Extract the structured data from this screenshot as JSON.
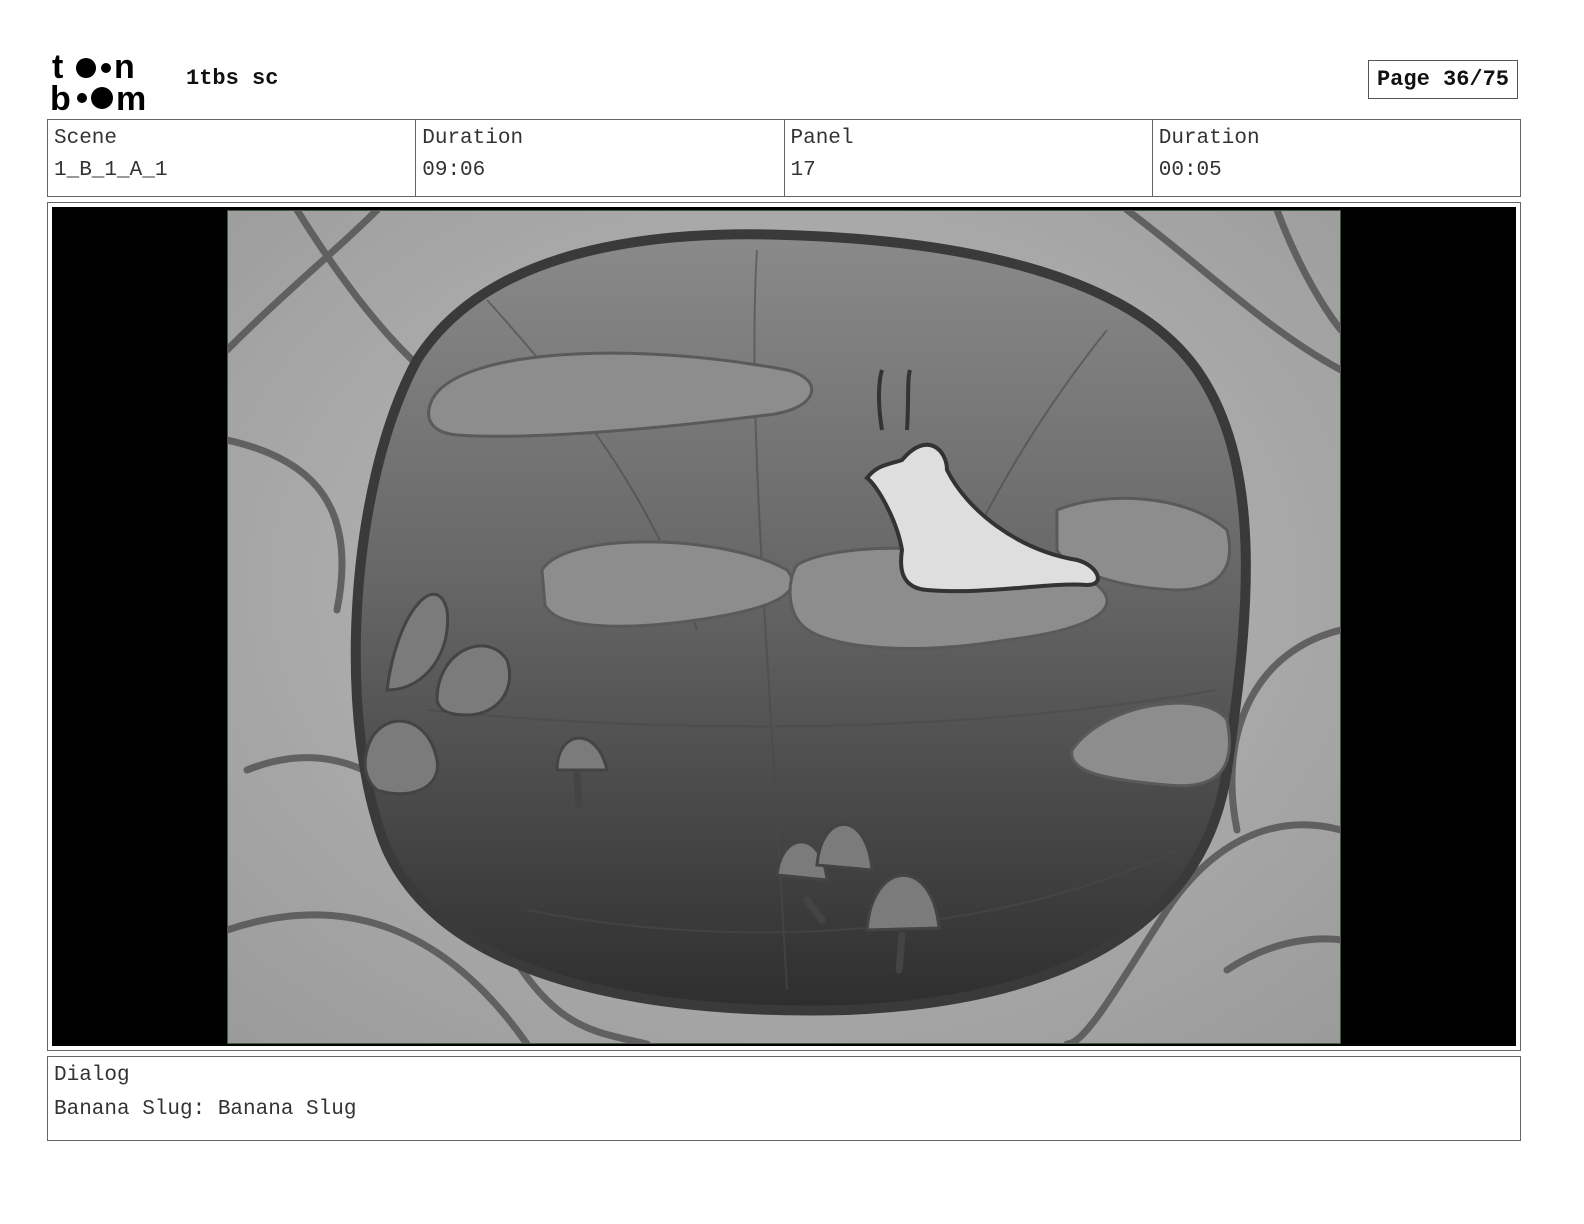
{
  "header": {
    "logo_text_top": "toon",
    "logo_text_bottom": "boom",
    "project_title": "1tbs sc",
    "page_label": "Page 36/75"
  },
  "info": {
    "scene_label": "Scene",
    "scene_value": "1_B_1_A_1",
    "scene_duration_label": "Duration",
    "scene_duration_value": "09:06",
    "panel_label": "Panel",
    "panel_value": "17",
    "panel_duration_label": "Duration",
    "panel_duration_value": "00:05"
  },
  "dialog": {
    "label": "Dialog",
    "text": "Banana Slug: Banana Slug"
  }
}
